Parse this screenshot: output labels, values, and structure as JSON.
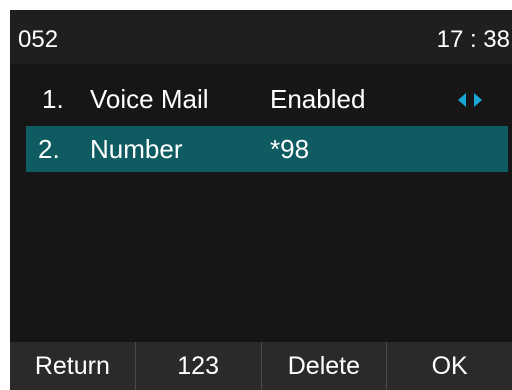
{
  "status_bar": {
    "account": "052",
    "time": "17 : 38"
  },
  "list": {
    "items": [
      {
        "index": "1.",
        "label": "Voice Mail",
        "value": "Enabled",
        "selected": false,
        "has_arrows": true
      },
      {
        "index": "2.",
        "label": "Number",
        "value": "*98",
        "selected": true,
        "has_arrows": false
      }
    ]
  },
  "softkeys": {
    "return_label": "Return",
    "input_mode_label": "123",
    "delete_label": "Delete",
    "ok_label": "OK"
  },
  "colors": {
    "background": "#161616",
    "selection": "#0e5c62",
    "arrow": "#19a7d6"
  },
  "icons": {
    "left_arrow": "triangle-left-icon",
    "right_arrow": "triangle-right-icon"
  }
}
